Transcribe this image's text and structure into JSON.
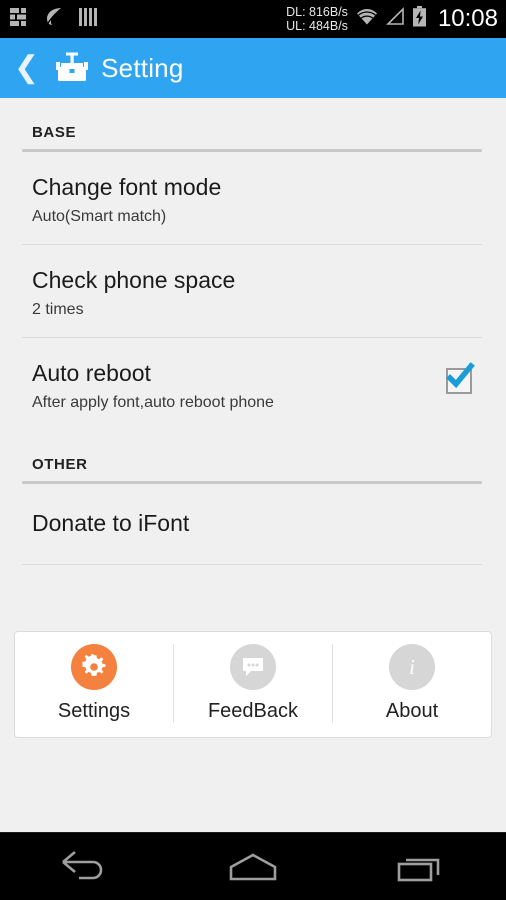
{
  "statusbar": {
    "left_icons": [
      "bricks-icon",
      "leaf-icon",
      "bars-icon"
    ],
    "download_speed": "DL: 816B/s",
    "upload_speed": "UL: 484B/s",
    "right_icons": [
      "wifi-icon",
      "signal-icon",
      "battery-charging-icon"
    ],
    "clock": "10:08"
  },
  "actionbar": {
    "back_icon": "back-chevron-icon",
    "app_icon": "ifont-logo-icon",
    "title": "Setting",
    "accent_color": "#2fa4f0"
  },
  "sections": [
    {
      "header": "BASE",
      "rows": [
        {
          "title": "Change font mode",
          "subtitle": "Auto(Smart match)",
          "control": "none"
        },
        {
          "title": "Check phone space",
          "subtitle": "2 times",
          "control": "none"
        },
        {
          "title": "Auto reboot",
          "subtitle": "After apply font,auto reboot phone",
          "control": "checkbox",
          "checked": true
        }
      ]
    },
    {
      "header": "OTHER",
      "rows": [
        {
          "title": "Donate to iFont",
          "subtitle": "",
          "control": "none"
        }
      ]
    }
  ],
  "tabs": [
    {
      "label": "Settings",
      "icon": "gear-icon",
      "color": "#f5813f",
      "active": true
    },
    {
      "label": "FeedBack",
      "icon": "speech-bubble-icon",
      "color": "#d6d6d6",
      "active": false
    },
    {
      "label": "About",
      "icon": "info-icon",
      "color": "#d6d6d6",
      "active": false
    }
  ],
  "navbar": {
    "back": "nav-back-icon",
    "home": "nav-home-icon",
    "recents": "nav-recents-icon"
  }
}
